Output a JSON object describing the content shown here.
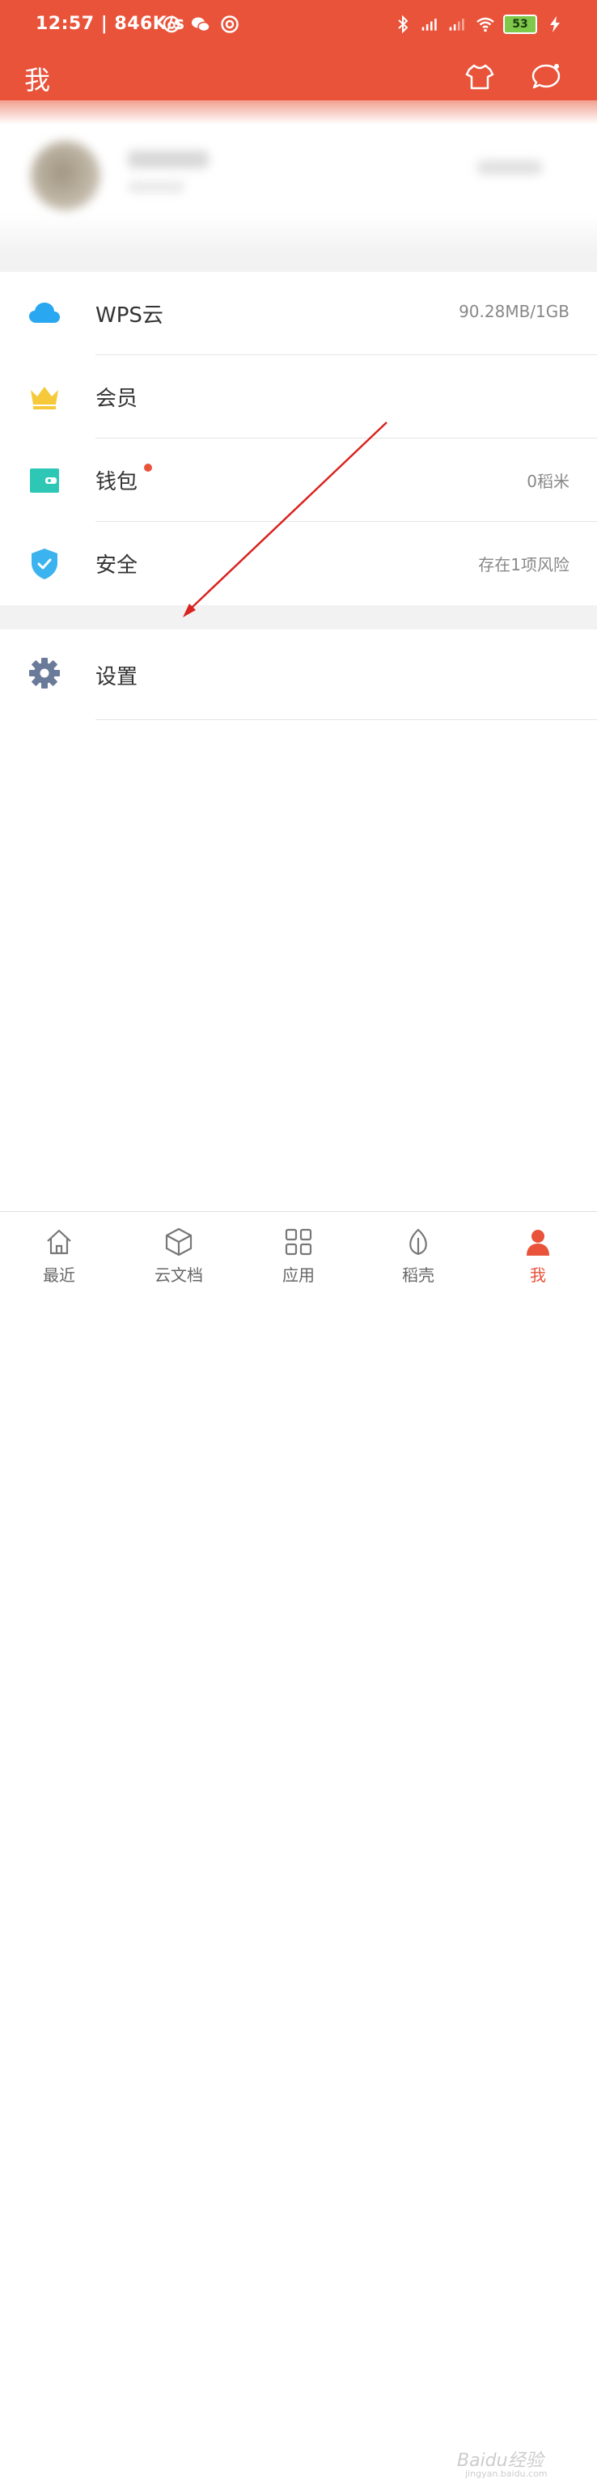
{
  "statusbar": {
    "text": "12:57 | 846K/s",
    "battery": "53"
  },
  "header": {
    "title": "我"
  },
  "menu_group1": [
    {
      "label": "WPS云",
      "value": "90.28MB/1GB",
      "icon": "cloud-icon"
    },
    {
      "label": "会员",
      "value": "",
      "icon": "crown-icon"
    },
    {
      "label": "钱包",
      "value": "0稻米",
      "icon": "wallet-icon",
      "badge": true
    },
    {
      "label": "安全",
      "value": "存在1项风险",
      "icon": "shield-icon"
    }
  ],
  "menu_group2": [
    {
      "label": "设置",
      "icon": "gear-icon"
    }
  ],
  "bottom_nav": [
    {
      "label": "最近",
      "icon": "home-icon"
    },
    {
      "label": "云文档",
      "icon": "cube-icon"
    },
    {
      "label": "应用",
      "icon": "grid-icon"
    },
    {
      "label": "稻壳",
      "icon": "leaf-icon"
    },
    {
      "label": "我",
      "icon": "person-icon",
      "active": true
    }
  ],
  "watermark": {
    "text": "Baidu经验",
    "sub": "jingyan.baidu.com"
  },
  "colors": {
    "brand": "#e8533a",
    "cloud": "#29a7f1",
    "crown": "#f6c93a",
    "wallet": "#2ec7b6",
    "shield": "#3bb3ef",
    "gear": "#6a7a99"
  }
}
